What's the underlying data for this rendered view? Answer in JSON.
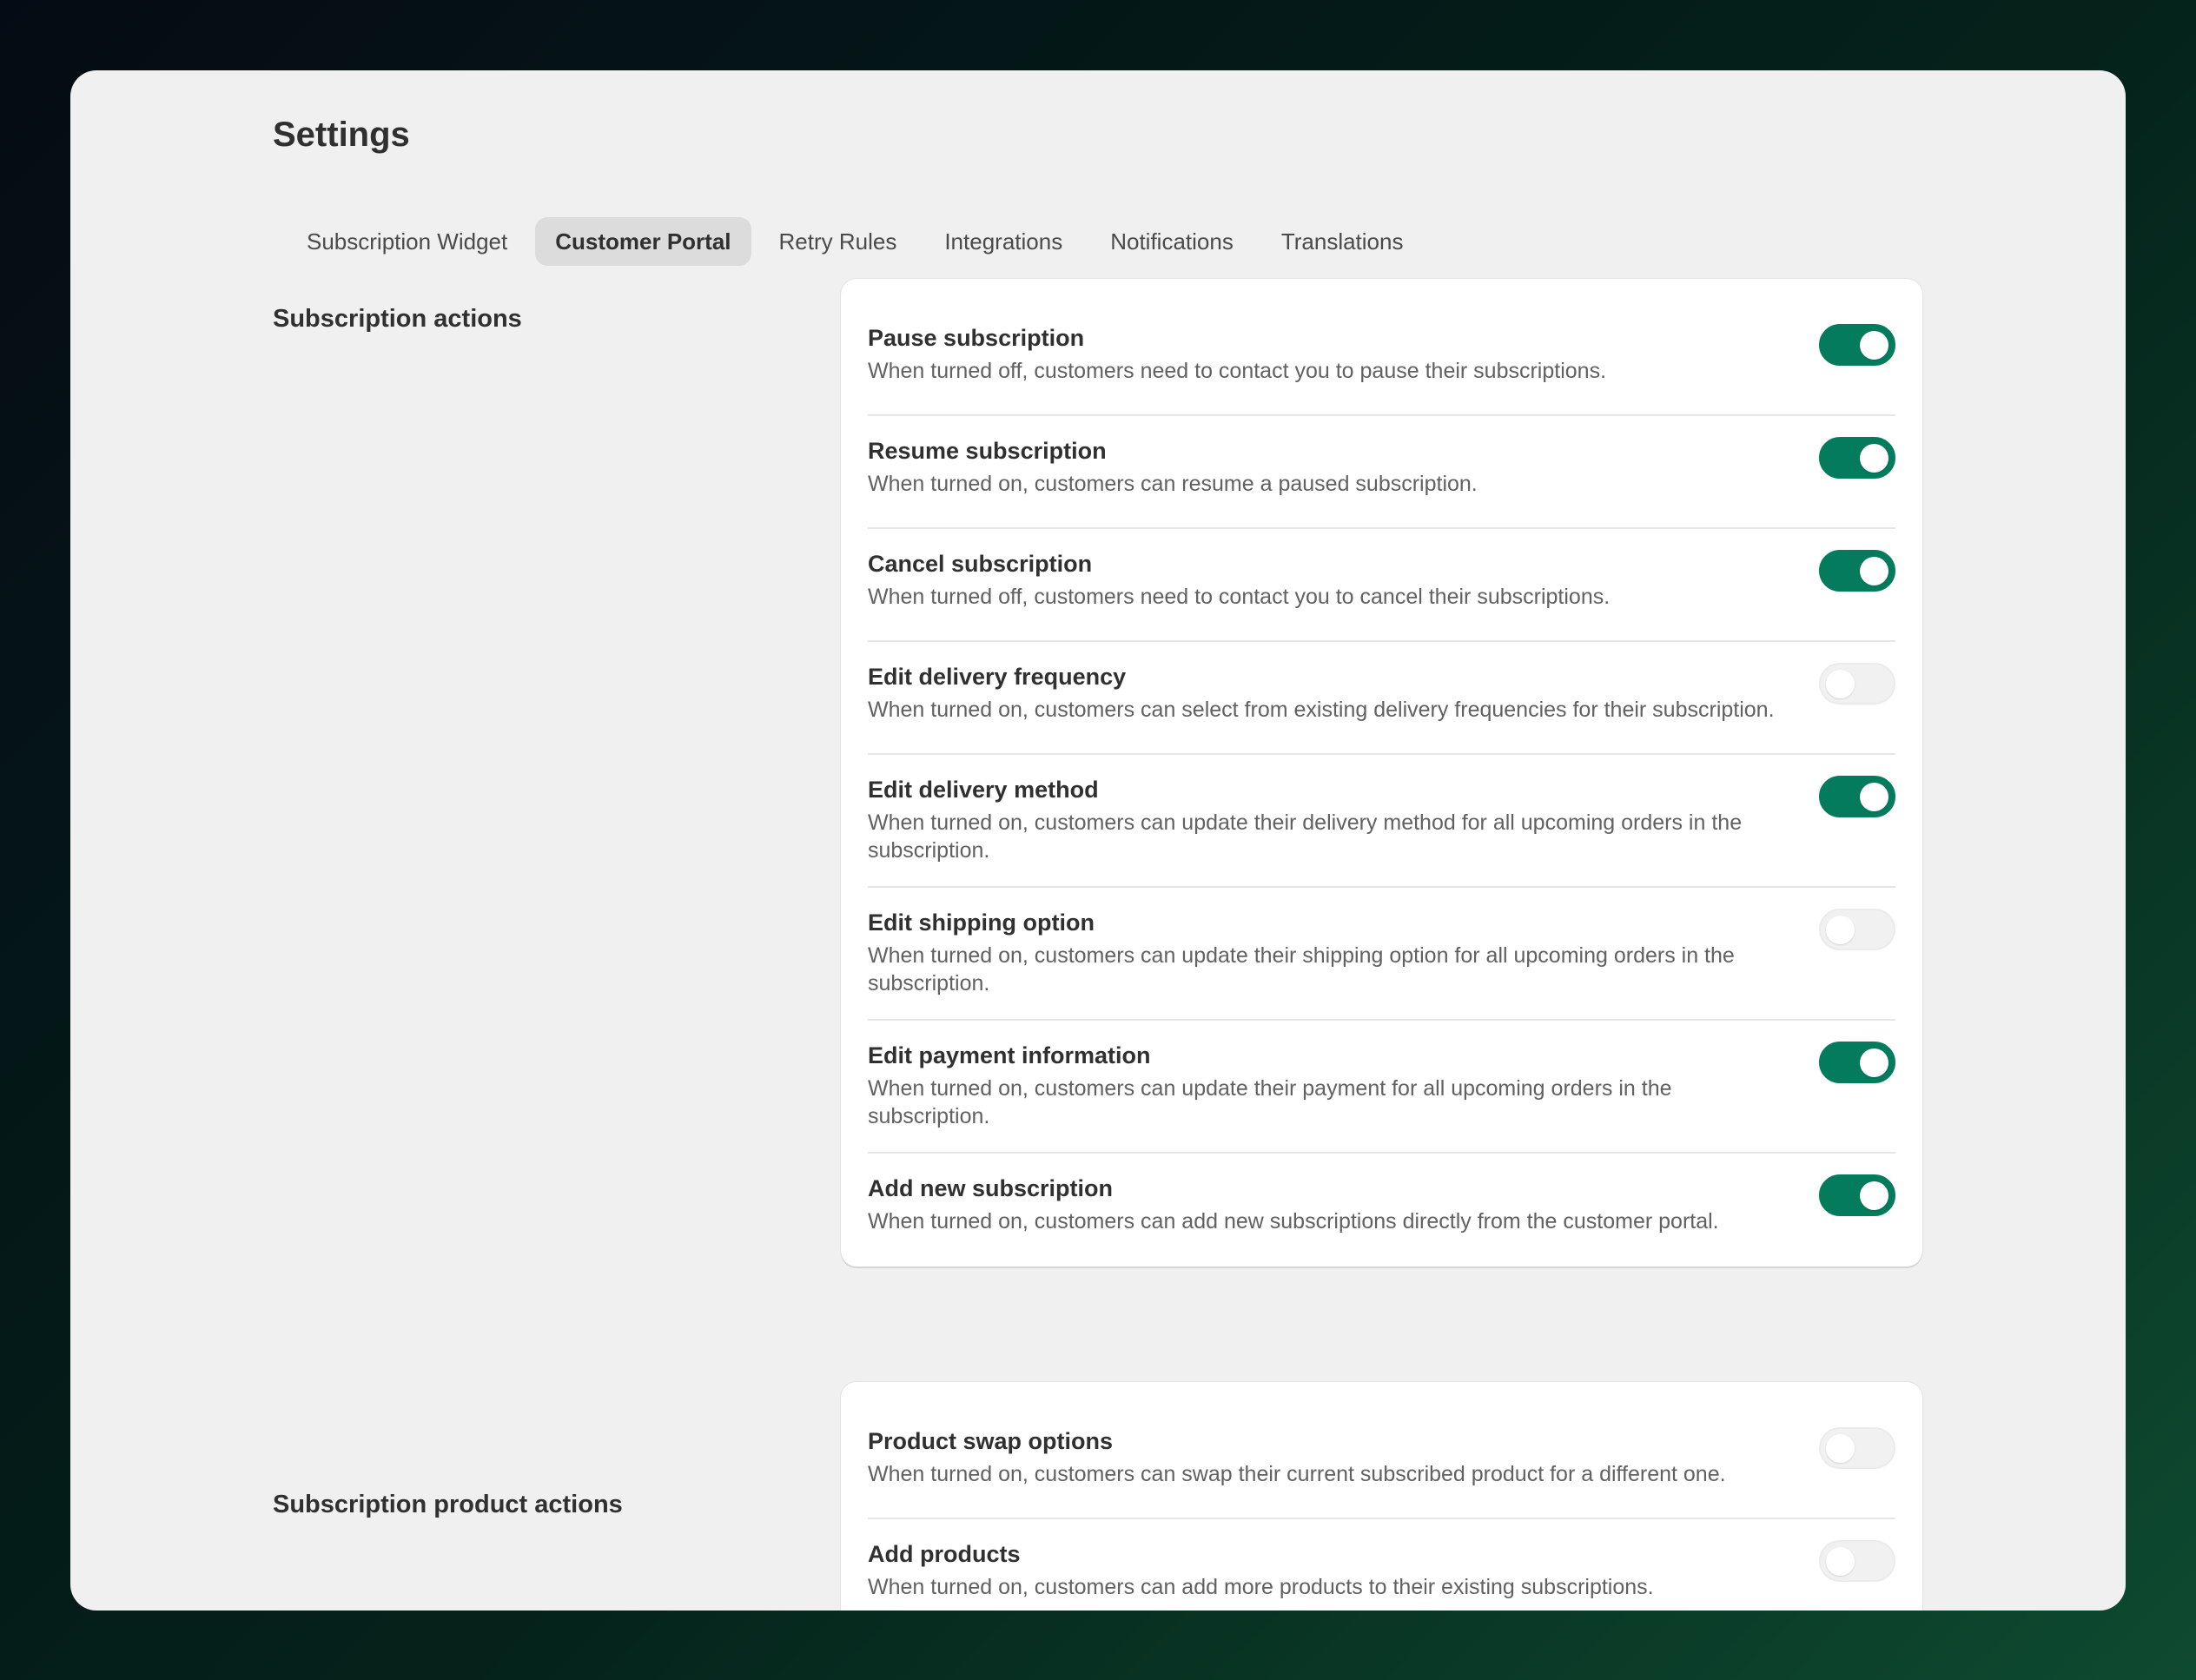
{
  "page": {
    "title": "Settings"
  },
  "tabs": [
    {
      "label": "Subscription Widget",
      "active": false
    },
    {
      "label": "Customer Portal",
      "active": true
    },
    {
      "label": "Retry Rules",
      "active": false
    },
    {
      "label": "Integrations",
      "active": false
    },
    {
      "label": "Notifications",
      "active": false
    },
    {
      "label": "Translations",
      "active": false
    }
  ],
  "colors": {
    "toggle_on": "#047b5d",
    "toggle_off": "#f1f1f1"
  },
  "sections": [
    {
      "label": "Subscription actions",
      "items": [
        {
          "title": "Pause subscription",
          "description": "When turned off, customers need to contact you to pause their subscriptions.",
          "enabled": true
        },
        {
          "title": "Resume subscription",
          "description": "When turned on, customers can resume a paused subscription.",
          "enabled": true
        },
        {
          "title": "Cancel subscription",
          "description": "When turned off, customers need to contact you to cancel their subscriptions.",
          "enabled": true
        },
        {
          "title": "Edit delivery frequency",
          "description": "When turned on, customers can select from existing delivery frequencies for their subscription.",
          "enabled": false
        },
        {
          "title": "Edit delivery method",
          "description": "When turned on, customers can update their delivery method for all upcoming orders in the subscription.",
          "enabled": true
        },
        {
          "title": "Edit shipping option",
          "description": "When turned on, customers can update their shipping option for all upcoming orders in the subscription.",
          "enabled": false
        },
        {
          "title": "Edit payment information",
          "description": "When turned on, customers can update their payment for all upcoming orders in the subscription.",
          "enabled": true
        },
        {
          "title": "Add new subscription",
          "description": "When turned on, customers can add new subscriptions directly from the customer portal.",
          "enabled": true
        }
      ]
    },
    {
      "label": "Subscription product actions",
      "items": [
        {
          "title": "Product swap options",
          "description": "When turned on, customers can swap their current subscribed product for a different one.",
          "enabled": false
        },
        {
          "title": "Add products",
          "description": "When turned on, customers can add more products to their existing subscriptions.",
          "enabled": false
        }
      ]
    }
  ]
}
